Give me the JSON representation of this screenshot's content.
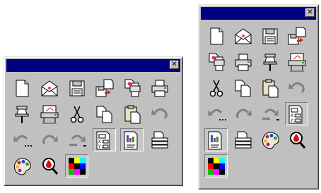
{
  "colors": {
    "title_bar": "#000080",
    "window_face": "#c0c0c0",
    "desktop": "#ffffff"
  },
  "palettes": [
    {
      "id": "pal-a",
      "title": "",
      "close_glyph": "✕",
      "tools": [
        {
          "icon": "new-document",
          "pressed": false
        },
        {
          "icon": "open-envelope",
          "pressed": false
        },
        {
          "icon": "save-disk",
          "pressed": false
        },
        {
          "icon": "save-transfer",
          "pressed": false
        },
        {
          "icon": "doc-printer",
          "pressed": false
        },
        {
          "icon": "printer",
          "pressed": false
        },
        {
          "icon": "push-pin",
          "pressed": false
        },
        {
          "icon": "plotter",
          "pressed": false
        },
        {
          "icon": "scissors",
          "pressed": false
        },
        {
          "icon": "copy",
          "pressed": false
        },
        {
          "icon": "paste",
          "pressed": false
        },
        {
          "icon": "undo",
          "pressed": false
        },
        {
          "icon": "undo-multiple",
          "pressed": false
        },
        {
          "icon": "redo",
          "pressed": false
        },
        {
          "icon": "redo-multiple",
          "pressed": false
        },
        {
          "icon": "properties",
          "pressed": true
        },
        {
          "icon": "chart-properties",
          "pressed": true
        },
        {
          "icon": "layer-stack",
          "pressed": false
        },
        {
          "icon": "color-palette",
          "pressed": false
        },
        {
          "icon": "magnifier-drop",
          "pressed": false
        },
        {
          "icon": "color-grid",
          "pressed": true
        }
      ]
    },
    {
      "id": "pal-b",
      "title": "",
      "close_glyph": "✕",
      "tools": [
        {
          "icon": "new-document",
          "pressed": false
        },
        {
          "icon": "open-envelope",
          "pressed": false
        },
        {
          "icon": "save-disk",
          "pressed": false
        },
        {
          "icon": "save-transfer",
          "pressed": false
        },
        {
          "icon": "doc-printer",
          "pressed": false
        },
        {
          "icon": "printer",
          "pressed": false
        },
        {
          "icon": "push-pin",
          "pressed": false
        },
        {
          "icon": "plotter",
          "pressed": false
        },
        {
          "icon": "scissors",
          "pressed": false
        },
        {
          "icon": "copy",
          "pressed": false
        },
        {
          "icon": "paste",
          "pressed": false
        },
        {
          "icon": "undo",
          "pressed": false
        },
        {
          "icon": "undo-multiple",
          "pressed": false
        },
        {
          "icon": "redo",
          "pressed": false
        },
        {
          "icon": "redo-multiple",
          "pressed": false
        },
        {
          "icon": "properties",
          "pressed": true
        },
        {
          "icon": "chart-properties",
          "pressed": true
        },
        {
          "icon": "layer-stack",
          "pressed": false
        },
        {
          "icon": "color-palette",
          "pressed": false
        },
        {
          "icon": "magnifier-drop",
          "pressed": false
        },
        {
          "icon": "color-grid",
          "pressed": true
        }
      ]
    }
  ]
}
